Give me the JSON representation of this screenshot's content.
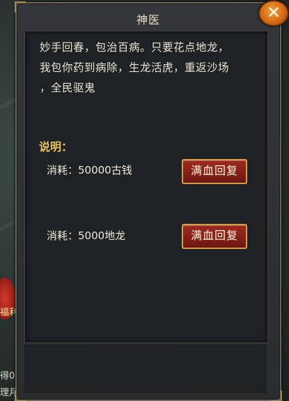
{
  "dialog": {
    "title": "神医",
    "close_icon_glyph": "✕",
    "description_lines": [
      "妙手回春，包治百病。只要花点地龙，",
      "我包你药到病除，生龙活虎，重返沙场",
      "，全民驱鬼"
    ],
    "section_label": "说明：",
    "options": [
      {
        "cost_label": "消耗：50000古钱",
        "button_label": "满血回复"
      },
      {
        "cost_label": "消耗：5000地龙",
        "button_label": "满血回复"
      }
    ]
  },
  "background": {
    "gift_label": "福利",
    "side_text_1": "得0",
    "side_text_2": "理月"
  },
  "colors": {
    "accent_gold": "#e8c36a",
    "button_red": "#9e2b1e",
    "close_orange": "#d46a14"
  }
}
